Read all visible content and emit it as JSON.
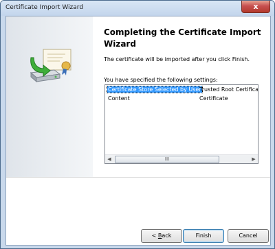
{
  "window": {
    "title": "Certificate Import Wizard",
    "close_glyph": "x"
  },
  "page": {
    "heading": "Completing the Certificate Import Wizard",
    "subtext": "The certificate will be imported after you click Finish.",
    "settings_label": "You have specified the following settings:"
  },
  "settings": [
    {
      "key": "Certificate Store Selected by User",
      "value": "Trusted Root Certifica"
    },
    {
      "key": "Content",
      "value": "Certificate"
    }
  ],
  "scrollbar": {
    "left_glyph": "◀",
    "right_glyph": "▶",
    "thumb_grip": "III"
  },
  "buttons": {
    "back_underline": "B",
    "back_rest": "ack",
    "back_prefix": "< ",
    "finish": "Finish",
    "cancel": "Cancel"
  },
  "icons": {
    "wizard": "certificate-install-icon"
  },
  "colors": {
    "selection": "#3399ff",
    "close": "#c75050"
  }
}
